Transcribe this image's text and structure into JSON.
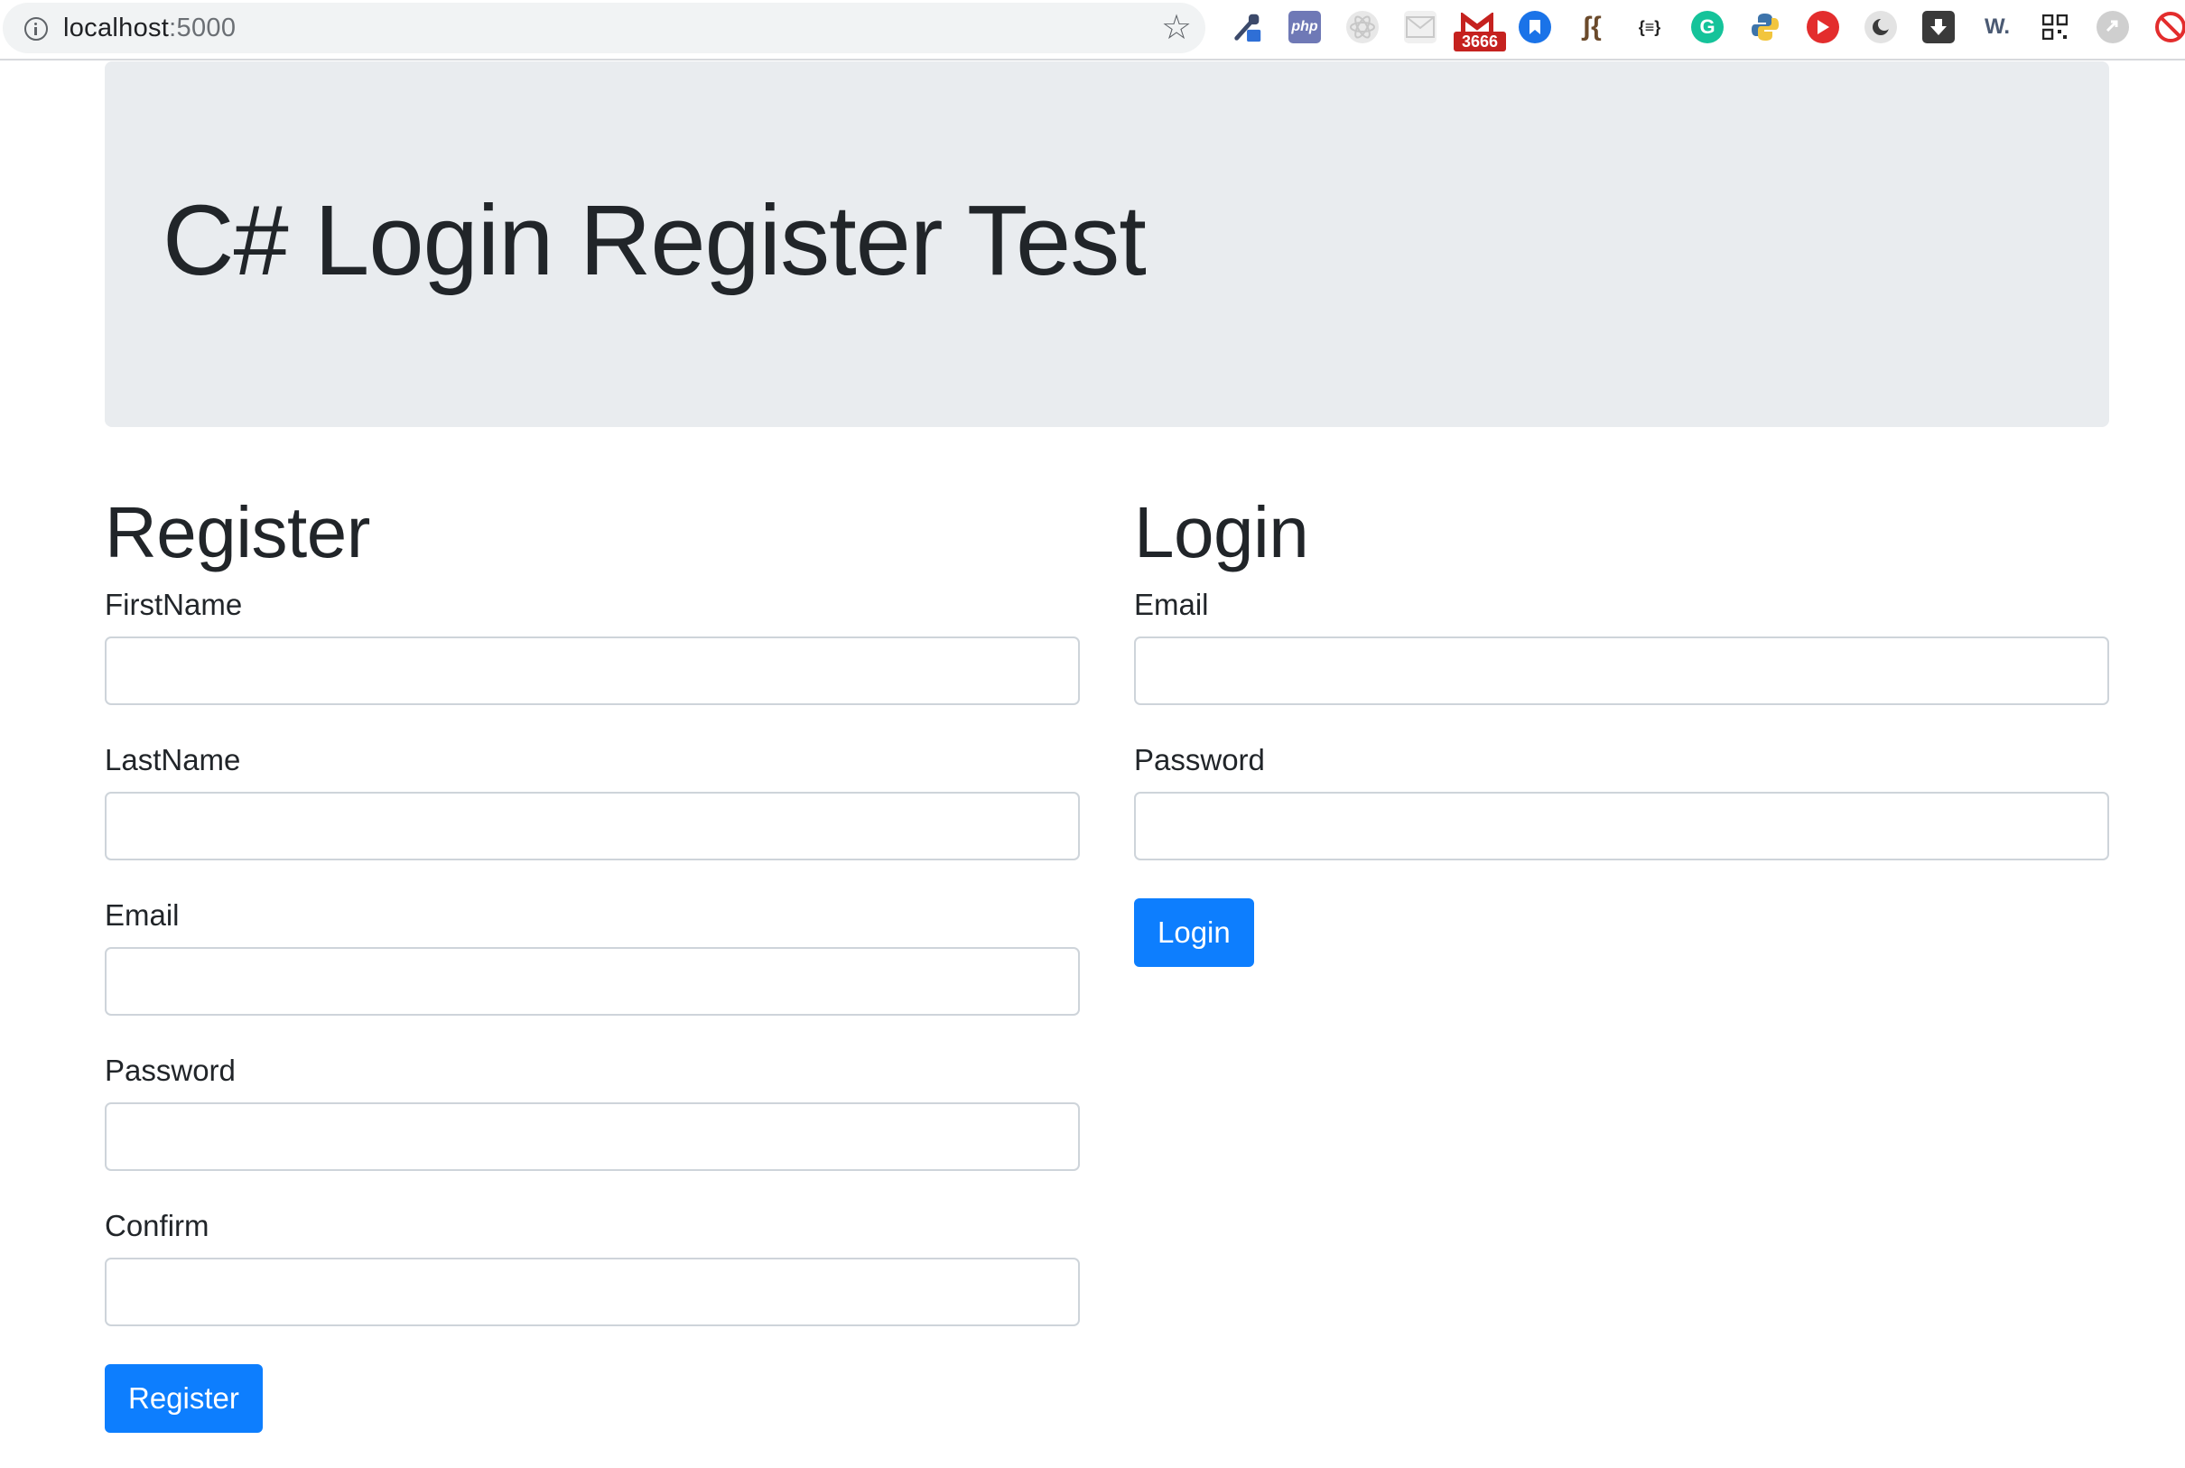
{
  "browser": {
    "url_host": "localhost",
    "url_port": ":5000",
    "extensions": [
      "eyedropper-icon",
      "php-icon",
      "react-icon",
      "mail-icon",
      "gmail-icon",
      "bookmark-icon",
      "code-icon",
      "json-icon",
      "grammarly-icon",
      "python-icon",
      "youtube-icon",
      "dark-mode-icon",
      "download-icon",
      "wikipedia-icon",
      "qr-code-icon",
      "extension-icon",
      "block-icon"
    ],
    "gmail_badge": "3666",
    "php_label": "php",
    "json_label": "{≡}",
    "wiki_label": "W."
  },
  "header": {
    "title": "C# Login Register Test"
  },
  "register": {
    "heading": "Register",
    "fields": [
      {
        "label": "FirstName",
        "value": ""
      },
      {
        "label": "LastName",
        "value": ""
      },
      {
        "label": "Email",
        "value": ""
      },
      {
        "label": "Password",
        "value": ""
      },
      {
        "label": "Confirm",
        "value": ""
      }
    ],
    "button": "Register"
  },
  "login": {
    "heading": "Login",
    "fields": [
      {
        "label": "Email",
        "value": ""
      },
      {
        "label": "Password",
        "value": ""
      }
    ],
    "button": "Login"
  },
  "colors": {
    "jumbotron_bg": "#e9ecef",
    "primary": "#0d7efe",
    "text": "#212529"
  }
}
